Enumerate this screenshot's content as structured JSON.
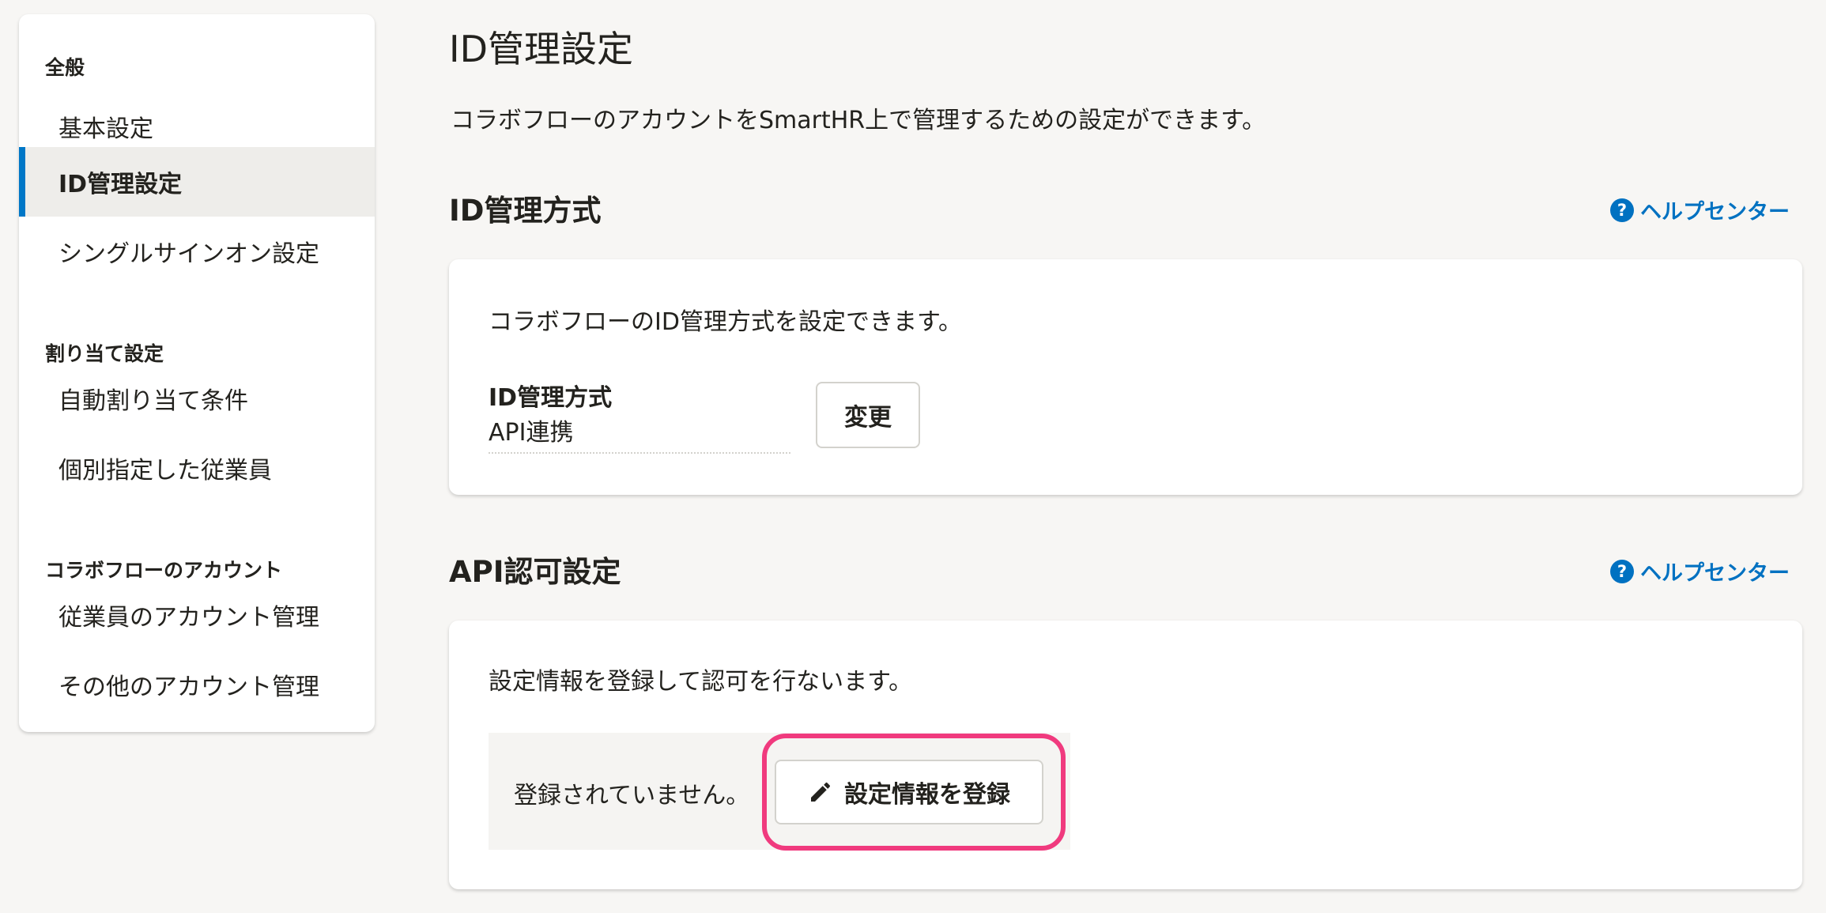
{
  "sidebar": {
    "groups": [
      {
        "title": "全般",
        "items": [
          "基本設定",
          "ID管理設定",
          "シングルサインオン設定"
        ]
      },
      {
        "title": "割り当て設定",
        "items": [
          "自動割り当て条件",
          "個別指定した従業員"
        ]
      },
      {
        "title": "コラボフローのアカウント",
        "items": [
          "従業員のアカウント管理",
          "その他のアカウント管理"
        ]
      }
    ],
    "active_item": "ID管理設定"
  },
  "main": {
    "title": "ID管理設定",
    "description": "コラボフローのアカウントをSmartHR上で管理するための設定ができます。",
    "sections": [
      {
        "title": "ID管理方式",
        "help_link": "ヘルプセンター",
        "card_description": "コラボフローのID管理方式を設定できます。",
        "field_label": "ID管理方式",
        "field_value": "API連携",
        "button_label": "変更"
      },
      {
        "title": "API認可設定",
        "help_link": "ヘルプセンター",
        "card_description": "設定情報を登録して認可を行ないます。",
        "status_text": "登録されていません。",
        "button_label": "設定情報を登録"
      }
    ]
  },
  "colors": {
    "accent": "#0077c7",
    "link": "#0071c1",
    "highlight": "#f03a7e",
    "background": "#f7f6f4"
  },
  "icons": {
    "help": "question-circle-icon",
    "edit": "pencil-icon"
  }
}
